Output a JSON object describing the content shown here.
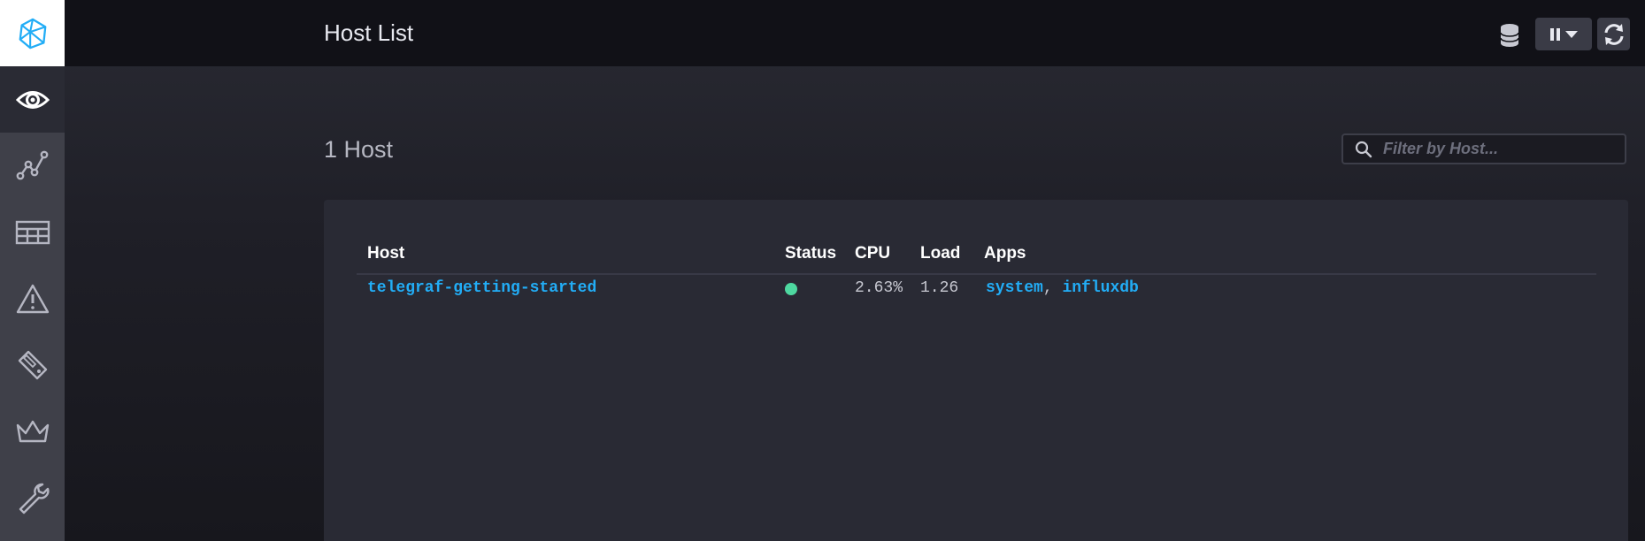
{
  "header": {
    "title": "Host List"
  },
  "sidebar": {
    "items": [
      {
        "icon": "eye-icon",
        "active": true
      },
      {
        "icon": "graph-icon",
        "active": false
      },
      {
        "icon": "table-icon",
        "active": false
      },
      {
        "icon": "alert-icon",
        "active": false
      },
      {
        "icon": "tag-icon",
        "active": false
      },
      {
        "icon": "crown-icon",
        "active": false
      },
      {
        "icon": "wrench-icon",
        "active": false
      }
    ]
  },
  "main": {
    "host_count": "1 Host",
    "filter": {
      "placeholder": "Filter by Host...",
      "value": ""
    },
    "table": {
      "columns": [
        "Host",
        "Status",
        "CPU",
        "Load",
        "Apps"
      ],
      "rows": [
        {
          "host": "telegraf-getting-started",
          "status": "up",
          "cpu": "2.63%",
          "load": "1.26",
          "apps": [
            "system",
            "influxdb"
          ],
          "apps_separator": ","
        }
      ]
    }
  },
  "colors": {
    "accent": "#22adf6",
    "status_up": "#4ed8a0",
    "sidebar_bg": "#3f4049",
    "header_bg": "#111117"
  }
}
